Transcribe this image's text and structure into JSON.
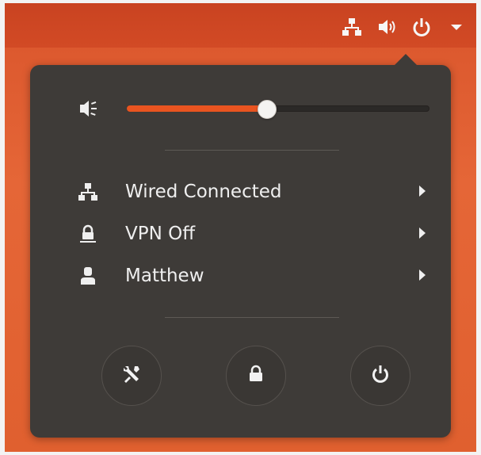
{
  "panel": {
    "status_icons": [
      "network-wired-icon",
      "volume-icon",
      "power-icon",
      "menu-arrow-icon"
    ]
  },
  "menu": {
    "volume": {
      "icon": "speaker-icon",
      "level": 0.46
    },
    "items": [
      {
        "label": "Wired Connected",
        "icon": "network-wired-icon"
      },
      {
        "label": "VPN Off",
        "icon": "vpn-lock-icon"
      },
      {
        "label": "Matthew",
        "icon": "user-icon"
      }
    ],
    "actions": [
      {
        "icon": "settings-icon"
      },
      {
        "icon": "lock-icon"
      },
      {
        "icon": "power-off-icon"
      }
    ]
  },
  "colors": {
    "accent": "#e95420",
    "panel_bg": "#3e3b38",
    "topbar_bg": "#c94321",
    "text": "#efefef"
  }
}
